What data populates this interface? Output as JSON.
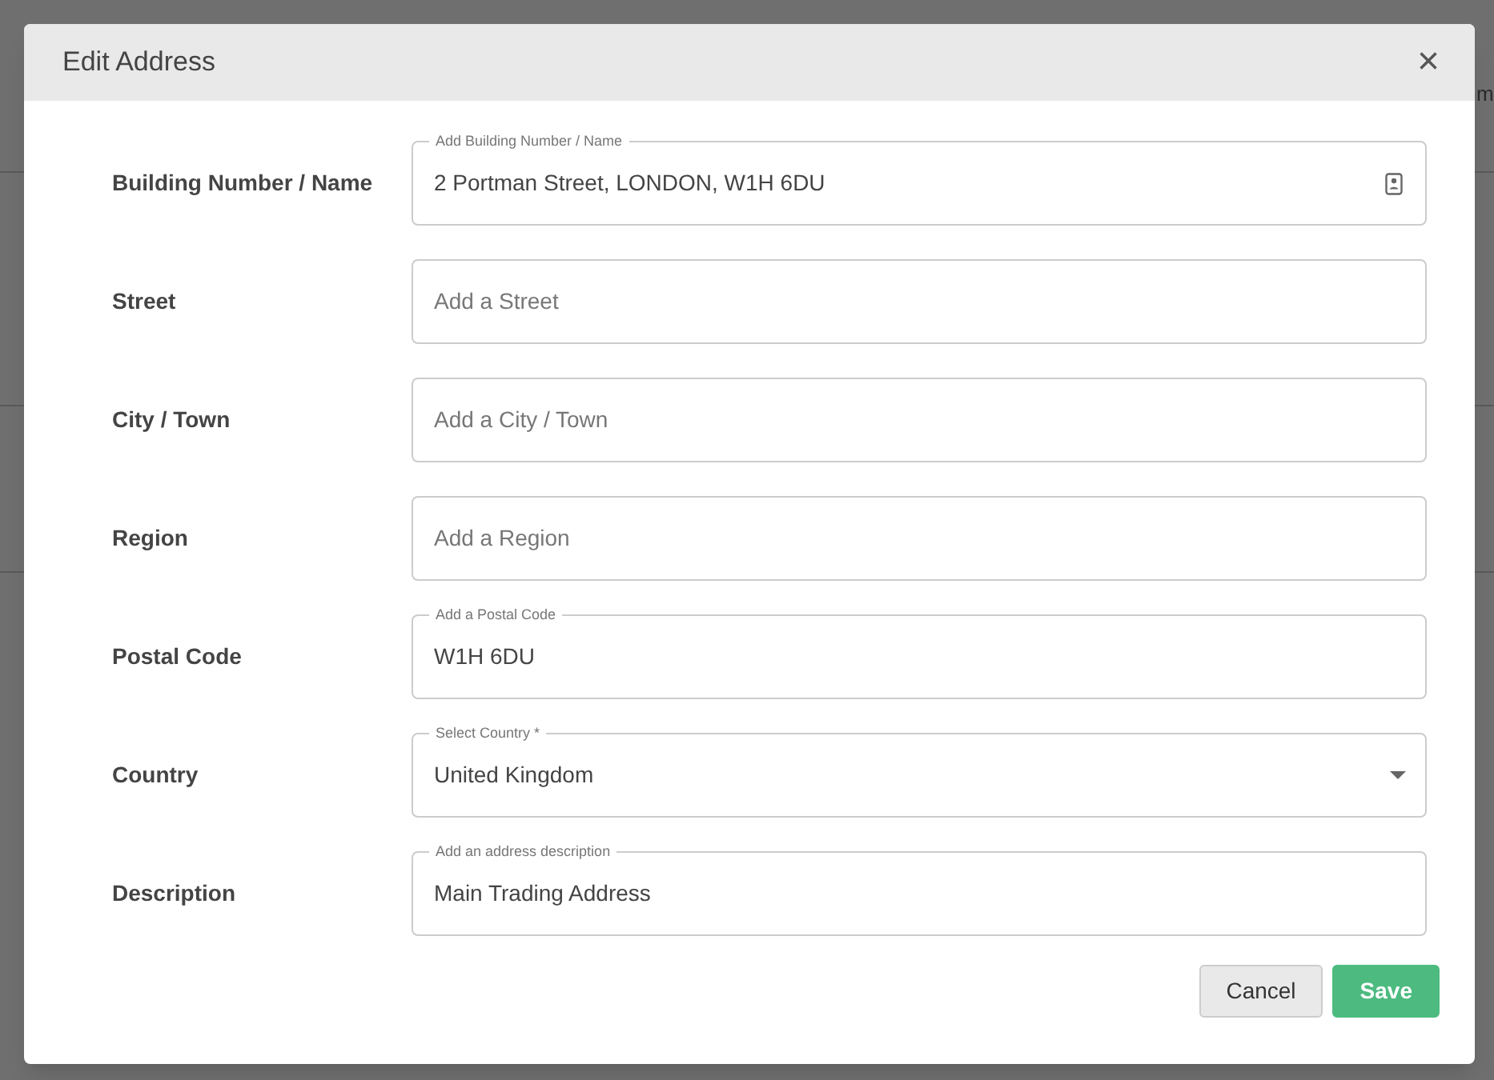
{
  "background": {
    "texts": [
      "m"
    ]
  },
  "dialog": {
    "title": "Edit Address",
    "close": "×",
    "fields": [
      {
        "label": "Building Number / Name",
        "kind": "text",
        "placeholder": "Add Building Number / Name",
        "value": "2 Portman Street, LONDON, W1H 6DU",
        "contact_icon": true
      },
      {
        "label": "Street",
        "kind": "text",
        "placeholder": "Add a Street"
      },
      {
        "label": "City / Town",
        "kind": "text",
        "placeholder": "Add a City / Town"
      },
      {
        "label": "Region",
        "kind": "text",
        "placeholder": "Add a Region"
      },
      {
        "label": "Postal Code",
        "kind": "text",
        "placeholder": "Add a Postal Code",
        "value": "W1H 6DU"
      },
      {
        "label": "Country",
        "kind": "select",
        "placeholder": "Select Country *",
        "value": "United Kingdom"
      },
      {
        "label": "Description",
        "kind": "text",
        "placeholder": "Add an address description",
        "value": "Main Trading Address"
      }
    ],
    "buttons": [
      {
        "label": "Cancel",
        "kind": "secondary"
      },
      {
        "label": "Save",
        "kind": "primary"
      }
    ]
  }
}
